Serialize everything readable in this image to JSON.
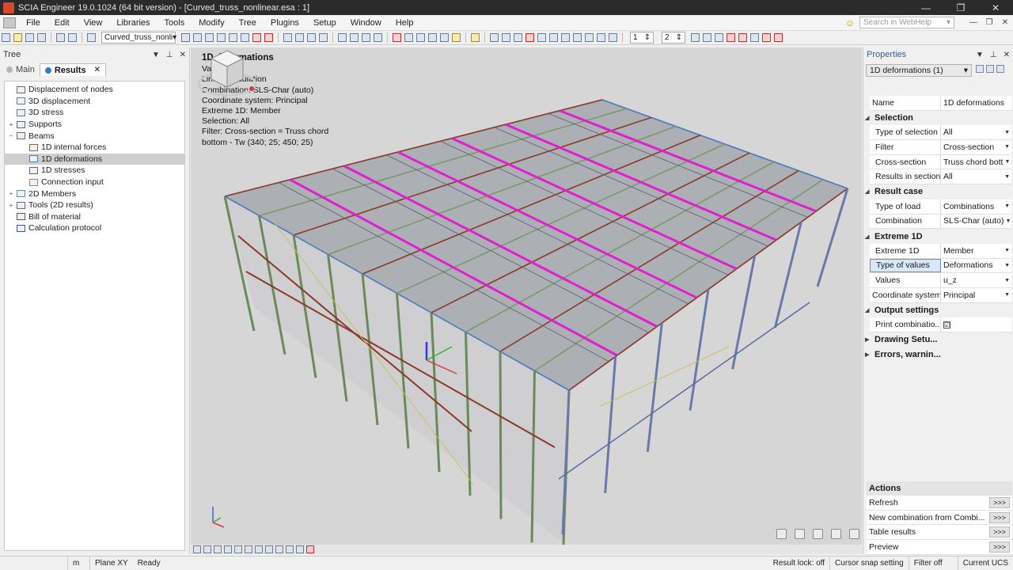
{
  "window": {
    "title": "SCIA Engineer 19.0.1024 (64 bit version) - [Curved_truss_nonlinear.esa : 1]",
    "controls": [
      "—",
      "❐",
      "✕"
    ]
  },
  "menu": {
    "items": [
      "File",
      "Edit",
      "View",
      "Libraries",
      "Tools",
      "Modify",
      "Tree",
      "Plugins",
      "Setup",
      "Window",
      "Help"
    ],
    "search_placeholder": "Search in WebHelp",
    "mdi_controls": [
      "—",
      "❐",
      "✕"
    ]
  },
  "toolbar": {
    "project_combo": "Curved_truss_nonli",
    "spin1": "1",
    "spin2": "2"
  },
  "tree_panel": {
    "title": "Tree",
    "tabs": [
      {
        "label": "Main",
        "active": false
      },
      {
        "label": "Results",
        "active": true
      }
    ],
    "items": [
      {
        "label": "Displacement of nodes",
        "level": 1,
        "expander": "",
        "icon_color": "#7a6a3a",
        "selected": false
      },
      {
        "label": "3D displacement",
        "level": 1,
        "expander": "",
        "icon_color": "#5a7aa0",
        "selected": false
      },
      {
        "label": "3D stress",
        "level": 1,
        "expander": "",
        "icon_color": "#5a7aa0",
        "selected": false
      },
      {
        "label": "Supports",
        "level": 1,
        "expander": "+",
        "icon_color": "#4a6ab0",
        "selected": false
      },
      {
        "label": "Beams",
        "level": 1,
        "expander": "−",
        "icon_color": "#6a6a6a",
        "selected": false
      },
      {
        "label": "1D internal forces",
        "level": 2,
        "expander": "",
        "icon_color": "#7a6a3a",
        "selected": false
      },
      {
        "label": "1D deformations",
        "level": 2,
        "expander": "",
        "icon_color": "#4a7ac0",
        "selected": true
      },
      {
        "label": "1D stresses",
        "level": 2,
        "expander": "",
        "icon_color": "#2a7a9a",
        "selected": false
      },
      {
        "label": "Connection input",
        "level": 2,
        "expander": "",
        "icon_color": "#8a8a8a",
        "selected": false
      },
      {
        "label": "2D Members",
        "level": 1,
        "expander": "+",
        "icon_color": "#6a8aaa",
        "selected": false
      },
      {
        "label": "Tools (2D results)",
        "level": 1,
        "expander": "+",
        "icon_color": "#7a6a3a",
        "selected": false
      },
      {
        "label": "Bill of material",
        "level": 1,
        "expander": "",
        "icon_color": "#3a5aa0",
        "selected": false
      },
      {
        "label": "Calculation protocol",
        "level": 1,
        "expander": "",
        "icon_color": "#3a5aa0",
        "selected": false
      }
    ]
  },
  "viewport": {
    "info_title": "1D deformations",
    "info_lines": [
      "Values: u₂",
      "Linear calculation",
      "Combination: SLS-Char (auto)",
      "Coordinate system: Principal",
      "Extreme 1D: Member",
      "Selection: All",
      "Filter: Cross-section = Truss chord",
      "bottom - Tw (340; 25; 450; 25)"
    ]
  },
  "properties": {
    "title": "Properties",
    "selector": "1D deformations (1)",
    "rows": [
      {
        "type": "row",
        "key": "Name",
        "value": "1D deformations",
        "dropdown": false,
        "indent": false
      },
      {
        "type": "section",
        "label": "Selection"
      },
      {
        "type": "row",
        "key": "Type of selection",
        "value": "All",
        "dropdown": true,
        "indent": true
      },
      {
        "type": "row",
        "key": "Filter",
        "value": "Cross-section",
        "dropdown": true,
        "indent": true
      },
      {
        "type": "row",
        "key": "Cross-section",
        "value": "Truss chord bott",
        "dropdown": true,
        "indent": true
      },
      {
        "type": "row",
        "key": "Results in sections",
        "value": "All",
        "dropdown": true,
        "indent": true
      },
      {
        "type": "section",
        "label": "Result case"
      },
      {
        "type": "row",
        "key": "Type of load",
        "value": "Combinations",
        "dropdown": true,
        "indent": true
      },
      {
        "type": "row",
        "key": "Combination",
        "value": "SLS-Char (auto)",
        "dropdown": true,
        "indent": true
      },
      {
        "type": "section",
        "label": "Extreme 1D"
      },
      {
        "type": "row",
        "key": "Extreme 1D",
        "value": "Member",
        "dropdown": true,
        "indent": true
      },
      {
        "type": "row",
        "key": "Type of values",
        "value": "Deformations",
        "dropdown": true,
        "indent": true,
        "highlight": true
      },
      {
        "type": "row",
        "key": "Values",
        "value": "u_z",
        "dropdown": true,
        "indent": true
      },
      {
        "type": "row",
        "key": "Coordinate system",
        "value": "Principal",
        "dropdown": true,
        "indent": false
      },
      {
        "type": "section",
        "label": "Output settings"
      },
      {
        "type": "row",
        "key": "Print combinatio...",
        "value": "☑",
        "dropdown": false,
        "indent": true,
        "checkbox": true
      },
      {
        "type": "section",
        "label": "Drawing Setu...",
        "collapsed": true
      },
      {
        "type": "section",
        "label": "Errors, warnin...",
        "collapsed": true
      }
    ],
    "actions_title": "Actions",
    "actions": [
      {
        "label": "Refresh",
        "button": ">>>"
      },
      {
        "label": "New combination from Combi...",
        "button": ">>>"
      },
      {
        "label": "Table results",
        "button": ">>>"
      },
      {
        "label": "Preview",
        "button": ">>>"
      }
    ]
  },
  "statusbar": {
    "unit": "m",
    "plane": "Plane XY",
    "state": "Ready",
    "result_lock": "Result lock: off",
    "cursor_snap": "Cursor snap setting",
    "filter": "Filter off",
    "ucs": "Current UCS"
  },
  "colors": {
    "selection_magenta": "#e020d0",
    "column_green": "#6a8a5a",
    "column_blue": "#6a7aa8",
    "beam_red": "#8a3a2a",
    "roof_gray": "#8a9098",
    "viewport_bg": "#d6d6d6"
  }
}
